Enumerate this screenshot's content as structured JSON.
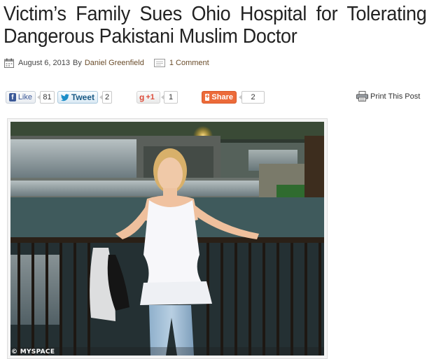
{
  "article": {
    "title": "Victim’s Family Sues Ohio Hospital for Tolerating Dangerous Pakistani Muslim Doctor",
    "date": "August 6, 2013",
    "by": "By",
    "author": "Daniel Greenfield",
    "comments": "1 Comment"
  },
  "share": {
    "facebook": {
      "label": "Like",
      "count": "81"
    },
    "twitter": {
      "label": "Tweet",
      "count": "2"
    },
    "google": {
      "label": "+1",
      "count": "1"
    },
    "share": {
      "label": "Share",
      "count": "2"
    },
    "print": "Print This Post"
  },
  "image": {
    "watermark": "© MYSPACE"
  },
  "colors": {
    "link": "#6a4c2a",
    "facebook": "#3b5998",
    "twitter": "#1c8dc8",
    "google": "#dd4b39",
    "share": "#ec6b3a"
  }
}
